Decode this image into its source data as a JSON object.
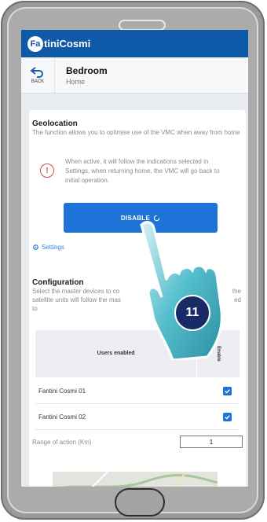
{
  "brand": {
    "logo_mark": "Fa",
    "logo_text": "tiniCosmi"
  },
  "header": {
    "back_label": "BACK",
    "title": "Bedroom",
    "subtitle": "Home"
  },
  "geolocation": {
    "title": "Geolocation",
    "description": "The function allows you to optimise use of the VMC when away from home",
    "info_text": "When active, it will follow the indications selected in Settings, when returning home, the VMC will go back to initial operation.",
    "info_icon": "exclamation-icon",
    "disable_button": "DISABLE",
    "settings_link": "Settings"
  },
  "configuration": {
    "title": "Configuration",
    "description_line1": "Select the master devices to co",
    "description_line1_tail": "the",
    "description_line2": "satellite units will follow the mas",
    "description_line2_tail": "ed",
    "description_line3": "to"
  },
  "users_table": {
    "headers": {
      "users": "Users enabled",
      "enable": "Enable"
    },
    "rows": [
      {
        "name": "Fantini Cosmi 01",
        "checked": true
      },
      {
        "name": "Fantini Cosmi 02",
        "checked": true
      }
    ]
  },
  "range": {
    "label": "Range of action (Km)",
    "value": "1"
  },
  "overlay": {
    "step_number": "11"
  },
  "colors": {
    "primary": "#1d73d8",
    "appbar": "#0f5aa8",
    "badge": "#1a2a66",
    "hand": "#4ab8c8"
  }
}
